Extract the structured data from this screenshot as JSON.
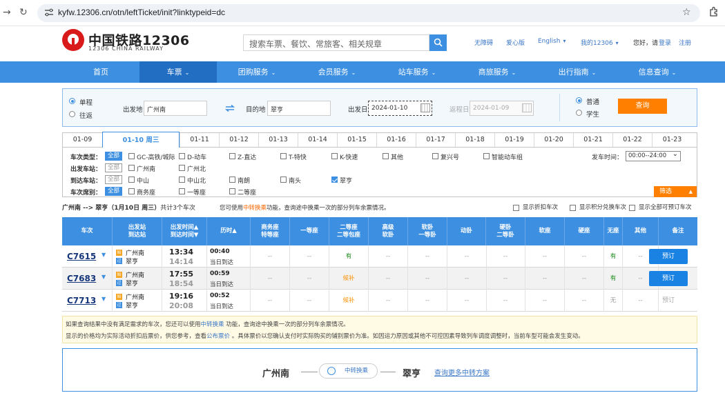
{
  "browser": {
    "url": "kyfw.12306.cn/otn/leftTicket/init?linktypeid=dc"
  },
  "header": {
    "logo_cn": "中国铁路12306",
    "logo_en": "12306 CHINA RAILWAY",
    "search_placeholder": "搜索车票、餐饮、常旅客、相关规章",
    "links": [
      "无障碍",
      "爱心版",
      "English",
      "我的12306"
    ],
    "greeting": "您好，请",
    "login": "登录",
    "register": "注册"
  },
  "nav": [
    {
      "label": "首页",
      "caret": false
    },
    {
      "label": "车票",
      "caret": true
    },
    {
      "label": "团购服务",
      "caret": true
    },
    {
      "label": "会员服务",
      "caret": true
    },
    {
      "label": "站车服务",
      "caret": true
    },
    {
      "label": "商旅服务",
      "caret": true
    },
    {
      "label": "出行指南",
      "caret": true
    },
    {
      "label": "信息查询",
      "caret": true
    }
  ],
  "form": {
    "trip_oneway": "单程",
    "trip_round": "往返",
    "from_label": "出发地",
    "from_value": "广州南",
    "to_label": "目的地",
    "to_value": "翠亨",
    "date_label": "出发日",
    "date_value": "2024-01-10",
    "return_label": "返程日",
    "return_value": "2024-01-09",
    "type_normal": "普通",
    "type_student": "学生",
    "query_btn": "查询"
  },
  "dates": [
    "01-09",
    "01-10 周三",
    "01-11",
    "01-12",
    "01-13",
    "01-14",
    "01-15",
    "01-16",
    "01-17",
    "01-18",
    "01-19",
    "01-20",
    "01-21",
    "01-22",
    "01-23"
  ],
  "filters": {
    "all": "全部",
    "type_label": "车次类型：",
    "types": [
      "GC-高铁/城际",
      "D-动车",
      "Z-直达",
      "T-特快",
      "K-快速",
      "其他",
      "复兴号",
      "智能动车组"
    ],
    "depart_time_label": "发车时间：",
    "depart_time_value": "00:00--24:00",
    "from_label": "出发车站：",
    "from_stations": [
      "广州南",
      "广州北"
    ],
    "to_label": "到达车站：",
    "to_stations": [
      "中山",
      "中山北",
      "南朗",
      "南头",
      "翠亨"
    ],
    "seat_label": "车次席别：",
    "seats": [
      "商务座",
      "一等座",
      "二等座"
    ],
    "filter_btn": "筛选"
  },
  "summary": {
    "route": "广州南 --> 翠亨",
    "date": "（1月10日 周三）",
    "count": "共计3个车次",
    "hint_pre": "您可使用",
    "hint_link": "中转换乘",
    "hint_post": "功能，查询途中换乘一次的部分列车余票情况。",
    "opt1": "显示折扣车次",
    "opt2": "显示积分兑换车次",
    "opt3": "显示全部可预订车次"
  },
  "table": {
    "headers": [
      {
        "l1": "车次",
        "l2": ""
      },
      {
        "l1": "出发站",
        "l2": "到达站"
      },
      {
        "l1": "出发时间▲",
        "l2": "到达时间▼"
      },
      {
        "l1": "历时▲",
        "l2": ""
      },
      {
        "l1": "商务座",
        "l2": "特等座"
      },
      {
        "l1": "一等座",
        "l2": ""
      },
      {
        "l1": "二等座",
        "l2": "二等包座"
      },
      {
        "l1": "高级",
        "l2": "软卧"
      },
      {
        "l1": "软卧",
        "l2": "一等卧"
      },
      {
        "l1": "动卧",
        "l2": ""
      },
      {
        "l1": "硬卧",
        "l2": "二等卧"
      },
      {
        "l1": "软座",
        "l2": ""
      },
      {
        "l1": "硬座",
        "l2": ""
      },
      {
        "l1": "无座",
        "l2": ""
      },
      {
        "l1": "其他",
        "l2": ""
      },
      {
        "l1": "备注",
        "l2": ""
      }
    ],
    "start_badge": "始",
    "pass_badge": "过",
    "rows": [
      {
        "no": "C7615",
        "from": "广州南",
        "to": "翠亨",
        "dep": "13:34",
        "arr": "14:14",
        "dur": "00:40",
        "day": "当日到达",
        "seats": [
          "--",
          "--",
          "有",
          "--",
          "--",
          "--",
          "--",
          "--",
          "--",
          "有",
          "--"
        ],
        "book": "预订",
        "bookable": true
      },
      {
        "no": "C7683",
        "from": "广州南",
        "to": "翠亨",
        "dep": "17:55",
        "arr": "18:54",
        "dur": "00:59",
        "day": "当日到达",
        "seats": [
          "--",
          "--",
          "候补",
          "--",
          "--",
          "--",
          "--",
          "--",
          "--",
          "有",
          "--"
        ],
        "book": "预订",
        "bookable": true
      },
      {
        "no": "C7713",
        "from": "广州南",
        "to": "翠亨",
        "dep": "19:16",
        "arr": "20:08",
        "dur": "00:52",
        "day": "当日到达",
        "seats": [
          "--",
          "--",
          "候补",
          "--",
          "--",
          "--",
          "--",
          "--",
          "--",
          "无",
          "--"
        ],
        "book": "预订",
        "bookable": false
      }
    ]
  },
  "notice": {
    "l1_pre": "如果查询结果中没有满足需求的车次，您还可以使用",
    "l1_link": "中转换乘",
    "l1_post": " 功能，查询途中换乘一次的部分列车余票情况。",
    "l2_pre": "显示的价格均为实际活动折扣后票价，供您参考，查看",
    "l2_link": "公布票价",
    "l2_post": " 。具体票价以您确认支付时实际购买的铺别票价为准。如因运力原因或其他不可控因素导致列车调度调整时，当前车型可能会发生变动。"
  },
  "transfer": {
    "from": "广州南",
    "to": "翠亨",
    "pill": "中转换乘",
    "more": "查询更多中转方案"
  }
}
